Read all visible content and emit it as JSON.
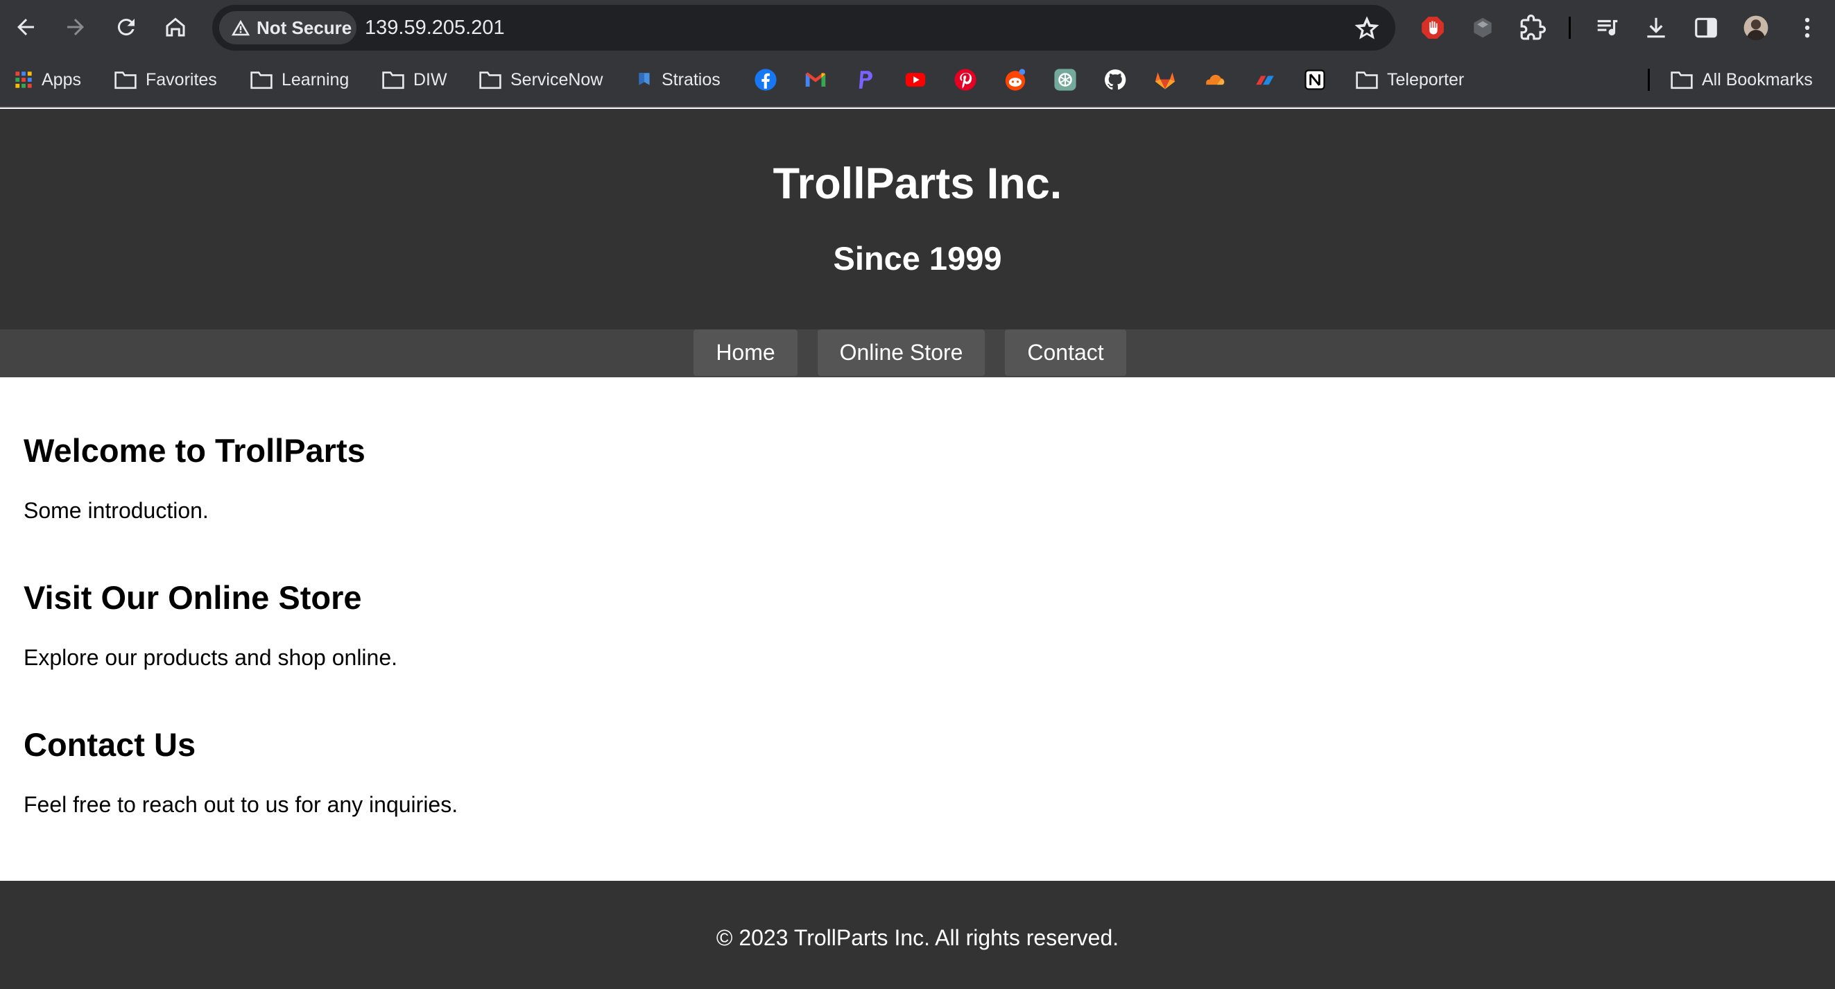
{
  "browser": {
    "security_label": "Not Secure",
    "url": "139.59.205.201",
    "bookmarks": {
      "apps": "Apps",
      "favorites": "Favorites",
      "learning": "Learning",
      "diw": "DIW",
      "servicenow": "ServiceNow",
      "stratios": "Stratios",
      "teleporter": "Teleporter",
      "all_bookmarks": "All Bookmarks"
    },
    "icons": [
      "back-icon",
      "forward-icon",
      "reload-icon",
      "home-icon",
      "warning-icon",
      "star-icon",
      "facebook-icon",
      "gmail-icon",
      "paypal-icon",
      "youtube-icon",
      "pinterest-icon",
      "reddit-icon",
      "chatgpt-icon",
      "github-icon",
      "gitlab-icon",
      "cloudflare-icon",
      "cloud-icon",
      "notion-icon"
    ]
  },
  "site": {
    "title": "TrollParts Inc.",
    "subtitle": "Since 1999",
    "nav": {
      "home": "Home",
      "store": "Online Store",
      "contact": "Contact"
    },
    "sections": [
      {
        "heading": "Welcome to TrollParts",
        "text": "Some introduction."
      },
      {
        "heading": "Visit Our Online Store",
        "text": "Explore our products and shop online."
      },
      {
        "heading": "Contact Us",
        "text": "Feel free to reach out to us for any inquiries."
      }
    ],
    "footer": "© 2023 TrollParts Inc. All rights reserved."
  },
  "colors": {
    "chrome": "#35363a",
    "omnibox": "#202124",
    "header_bg": "#333333",
    "nav_bg": "#444444",
    "nav_button": "#555555"
  }
}
